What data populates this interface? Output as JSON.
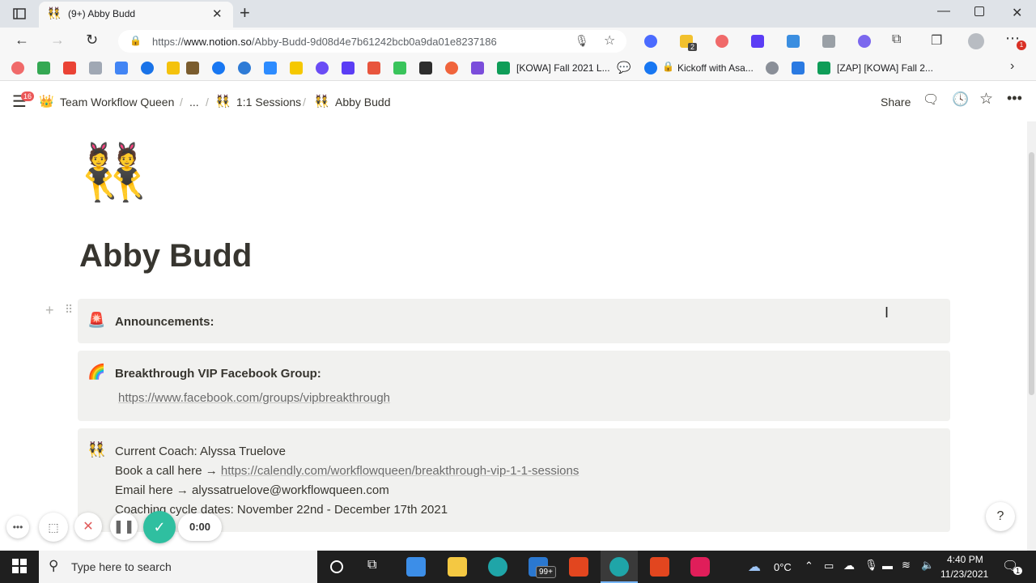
{
  "browser": {
    "tab_title": "(9+) Abby Budd",
    "url_prefix": "https://",
    "url_host": "www.notion.so",
    "url_path": "/Abby-Budd-9d08d4e7b61242bcb0a9da01e8237186",
    "extension_badge": "2",
    "notifications_badge": "1"
  },
  "bookmarks": [
    {
      "label": "[KOWA] Fall 2021 L..."
    },
    {
      "label": "Kickoff with Asa..."
    },
    {
      "label": "[ZAP] [KOWA] Fall 2..."
    }
  ],
  "notion": {
    "menu_badge": "16",
    "breadcrumb": [
      {
        "icon": "👑",
        "label": "Team Workflow Queen"
      },
      {
        "icon": "",
        "label": "..."
      },
      {
        "icon": "👯",
        "label": "1:1 Sessions"
      },
      {
        "icon": "👯",
        "label": "Abby Budd"
      }
    ],
    "share_label": "Share"
  },
  "page": {
    "icon": "👯",
    "title": "Abby Budd",
    "callouts": [
      {
        "emoji": "🚨",
        "heading": "Announcements:"
      },
      {
        "emoji": "🌈",
        "heading": "Breakthrough VIP Facebook Group:",
        "link": "https://www.facebook.com/groups/vipbreakthrough"
      },
      {
        "emoji": "👯",
        "coach_line": "Current Coach: Alyssa Truelove",
        "book_prefix": "Book a call here →",
        "book_link": "https://calendly.com/workflowqueen/breakthrough-vip-1-1-sessions",
        "email_line": "Email here → alyssatruelove@workflowqueen.com",
        "cycle_line": "Coaching cycle dates: November 22nd - December 17th 2021"
      }
    ],
    "help_label": "?"
  },
  "recorder": {
    "timer": "0:00"
  },
  "taskbar": {
    "search_placeholder": "Type here to search",
    "mail_badge": "99+",
    "weather": "0°C",
    "time": "4:40 PM",
    "date": "11/23/2021",
    "notification_count": "1"
  },
  "colors": {
    "callout_bg": "#f1f1ef",
    "text": "#37352f",
    "recorder_check": "#2fbfa0",
    "recorder_close": "#e05a5a"
  }
}
